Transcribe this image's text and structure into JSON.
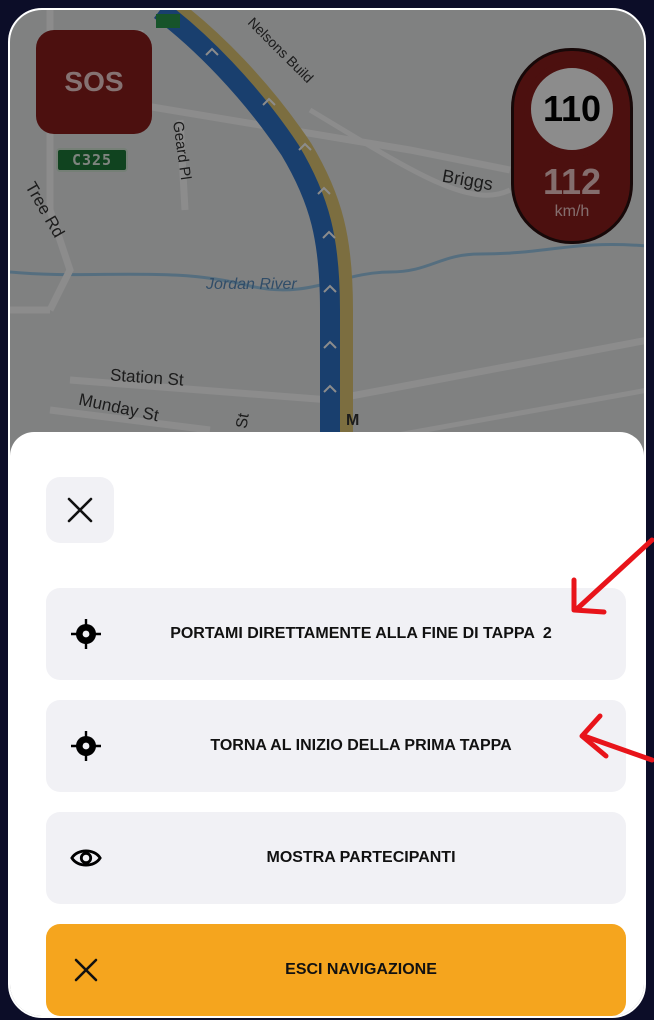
{
  "map": {
    "streets": [
      "Nelsons Build",
      "Geard Pl",
      "Briggs",
      "Tree Rd",
      "Jordan River",
      "Station St",
      "Munday St",
      "St",
      "M"
    ]
  },
  "sos_label": "SOS",
  "road_shield": "C325",
  "speed": {
    "limit": "110",
    "current": "112",
    "unit": "km/h"
  },
  "menu": {
    "options": [
      {
        "label": "PORTAMI DIRETTAMENTE ALLA FINE DI TAPPA",
        "badge": "2",
        "icon": "crosshair-icon"
      },
      {
        "label": "TORNA AL INIZIO DELLA PRIMA TAPPA",
        "icon": "crosshair-icon"
      },
      {
        "label": "MOSTRA PARTECIPANTI",
        "icon": "eye-icon"
      },
      {
        "label": "ESCI NAVIGAZIONE",
        "icon": "close-icon"
      }
    ]
  },
  "colors": {
    "background": "#0c0d28",
    "sos": "#8a1e1c",
    "exit_button": "#f5a51e",
    "option_bg": "#f1f1f5",
    "annotation_arrow": "#e8141a"
  }
}
